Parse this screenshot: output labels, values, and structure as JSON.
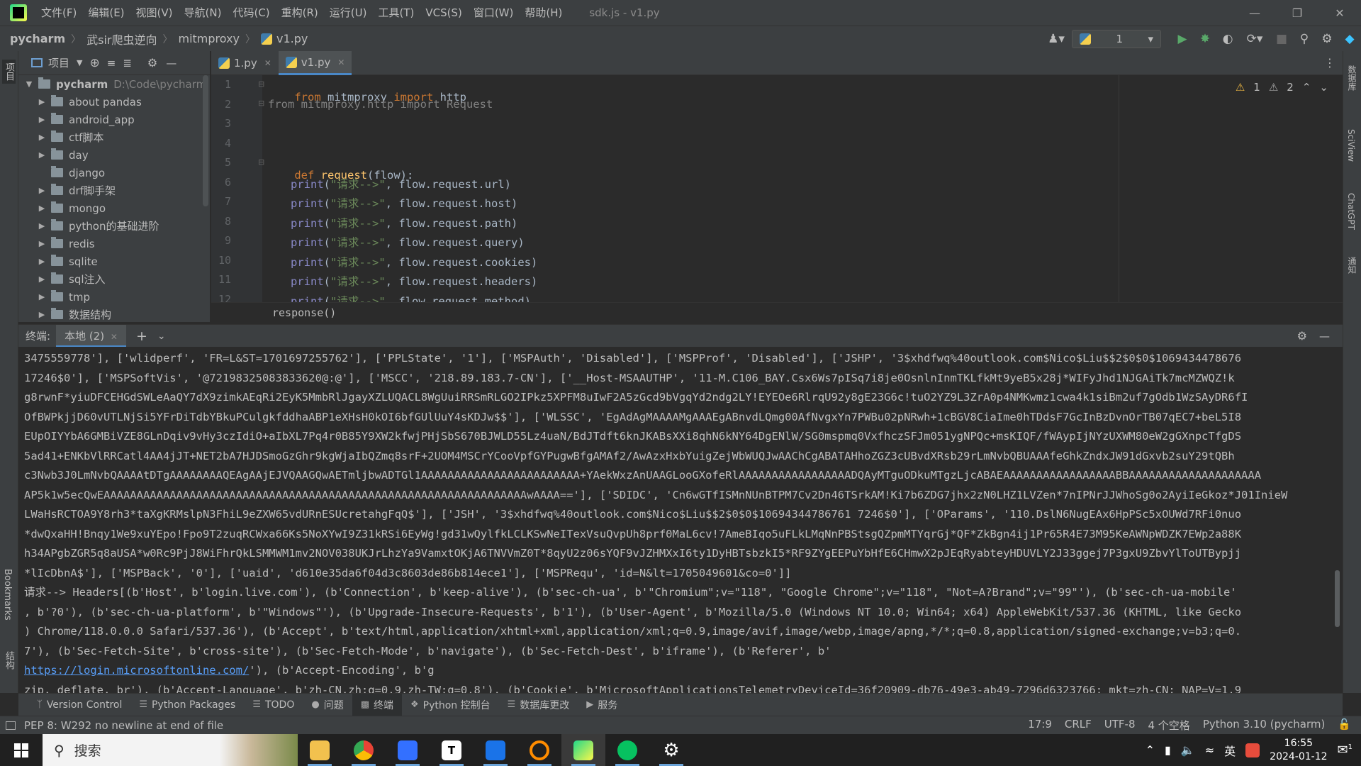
{
  "menubar": {
    "items": [
      "文件(F)",
      "编辑(E)",
      "视图(V)",
      "导航(N)",
      "代码(C)",
      "重构(R)",
      "运行(U)",
      "工具(T)",
      "VCS(S)",
      "窗口(W)",
      "帮助(H)"
    ],
    "title": "sdk.js - v1.py"
  },
  "navbar": {
    "crumbs": [
      "pycharm",
      "武sir爬虫逆向",
      "mitmproxy",
      "v1.py"
    ],
    "run_config": "1"
  },
  "left_strip": {
    "project": "项目",
    "bookmarks": "Bookmarks",
    "structure": "结构"
  },
  "right_strip": {
    "database": "数据库",
    "sciview": "SciView",
    "chatgpt": "ChatGPT",
    "notifications": "通知"
  },
  "project_panel": {
    "title": "项目",
    "root_name": "pycharm",
    "root_path": "D:\\Code\\pycharm",
    "folders": [
      {
        "name": "about pandas",
        "expandable": true
      },
      {
        "name": "android_app",
        "expandable": true
      },
      {
        "name": "ctf脚本",
        "expandable": true
      },
      {
        "name": "day",
        "expandable": true
      },
      {
        "name": "django",
        "expandable": false
      },
      {
        "name": "drf脚手架",
        "expandable": true
      },
      {
        "name": "mongo",
        "expandable": true
      },
      {
        "name": "python的基础进阶",
        "expandable": true
      },
      {
        "name": "redis",
        "expandable": true
      },
      {
        "name": "sqlite",
        "expandable": true
      },
      {
        "name": "sql注入",
        "expandable": true
      },
      {
        "name": "tmp",
        "expandable": true
      },
      {
        "name": "数据结构",
        "expandable": true
      }
    ]
  },
  "editor": {
    "tabs": [
      {
        "label": "1.py",
        "active": false
      },
      {
        "label": "v1.py",
        "active": true
      }
    ],
    "warnings": "1",
    "weak_warnings": "2",
    "line_numbers": [
      "1",
      "2",
      "3",
      "4",
      "5",
      "6",
      "7",
      "8",
      "9",
      "10",
      "11",
      "12"
    ],
    "lines": {
      "l1": {
        "kw1": "from",
        "mod": " mitmproxy ",
        "kw2": "import",
        "rest": " http"
      },
      "l2": "from mitmproxy.http import Request",
      "l5": {
        "kw": "def",
        "fn": "request",
        "rest": "(flow):"
      },
      "prints": [
        {
          "fn": "print",
          "str": "\"请求-->\"",
          "arg": "flow.request.url"
        },
        {
          "fn": "print",
          "str": "\"请求-->\"",
          "arg": "flow.request.host"
        },
        {
          "fn": "print",
          "str": "\"请求-->\"",
          "arg": "flow.request.path"
        },
        {
          "fn": "print",
          "str": "\"请求-->\"",
          "arg": "flow.request.query"
        },
        {
          "fn": "print",
          "str": "\"请求-->\"",
          "arg": "flow.request.cookies"
        },
        {
          "fn": "print",
          "str": "\"请求-->\"",
          "arg": "flow.request.headers"
        },
        {
          "fn": "print",
          "str": "\"请求-->\"",
          "arg": "flow.request.method"
        }
      ],
      "punct": {
        "open": "(",
        "comma": ", ",
        "close": ")"
      }
    },
    "breadcrumb": "response()"
  },
  "terminal": {
    "label": "终端:",
    "tab": "本地 (2)",
    "lines": [
      "3475559778'], ['wlidperf', 'FR=L&ST=1701697255762'], ['PPLState', '1'], ['MSPAuth', 'Disabled'], ['MSPProf', 'Disabled'], ['JSHP', '3$xhdfwq%40outlook.com$Nico$Liu$$2$0$0$1069434478676",
      "17246$0'], ['MSPSoftVis', '@72198325083833620@:@'], ['MSCC', '218.89.183.7-CN'], ['__Host-MSAAUTHP', '11-M.C106_BAY.Csx6Ws7pISq7i8je0OsnlnInmTKLfkMt9yeB5x28j*WIFyJhd1NJGAiTk7mcMZWQZ!k",
      "g8rwnF*yiuDFCEHGdSWLeAaQY7dX9zimkAEqRi2EyK5MmbRlJgayXZLUQACL8WgUuiRRSmRLGO2IPkz5XPFM8uIwF2A5zGcd9bVgqYd2ndg2LY!EYEOe6RlrqU92y8gE23G6c!tuO2YZ9L3ZrA0p4NMKwmz1cwa4k1siBm2uf7gOdb1WzSAyDR6fI",
      "OfBWPkjjD60vUTLNjSi5YFrDiTdbYBkuPCulgkfddhaABP1eXHsH0kOI6bfGUlUuY4sKDJw$$'], ['WLSSC', 'EgAdAgMAAAAMgAAAEgABnvdLQmg00AfNvgxYn7PWBu02pNRwh+1cBGV8CiaIme0hTDdsF7GcInBzDvnOrTB07qEC7+beL5I8",
      "EUpOIYYbA6GMBiVZE8GLnDqiv9vHy3czIdiO+aIbXL7Pq4r0B85Y9XW2kfwjPHjSbS670BJWLD55Lz4uaN/BdJTdft6knJKABsXXi8qhN6kNY64DgENlW/SG0mspmq0VxfhczSFJm051ygNPQc+msKIQF/fWAypIjNYzUXWM80eW2gGXnpcTfgDS",
      "5ad41+ENKbVlRRCatl4AA4jJT+NET2bA7HJDSmoGzGhr9kgWjaIbQZmq8srF+2UOM4MSCrYCooVpfGYPugwBfgAMAf2/AwAzxHxbYuigZejWbWUQJwAAChCgABATAHhoZGZ3cUBvdXRsb29rLmNvbQBUAAAfeGhkZndxJW91dGxvb2suY29tQBh",
      "c3Nwb3J0LmNvbQAAAAtDTgAAAAAAAAQEAgAAjEJVQAAGQwAETmljbwADTGl1AAAAAAAAAAAAAAAAAAAAAAAA+YAekWxzAnUAAGLooGXofeRlAAAAAAAAAAAAAAAAADQAyMTguODkuMTgzLjcABAEAAAAAAAAAAAAAAAAABBAAAAAAAAAAAAAAAAAAAA",
      "AP5k1w5ecQwEAAAAAAAAAAAAAAAAAAAAAAAAAAAAAAAAAAAAAAAAAAAAAAAAAAAAAAAAAAAAAAAAwAAAA=='], ['SDIDC', 'Cn6wGTfISMnNUnBTPM7Cv2Dn46TSrkAM!Ki7b6ZDG7jhx2zN0LHZ1LVZen*7nIPNrJJWhoSg0o2AyiIeGkoz*J01InieW",
      "LWaHsRCTOA9Y8rh3*taXgKRMslpN3FhiL9eZXW65vdURnESUcretahgFqQ$'], ['JSH', '3$xhdfwq%40outlook.com$Nico$Liu$$2$0$0$10694344786761 7246$0'], ['OParams', '110.DslN6NugEAx6HpPSc5xOUWd7RFi0nuo",
      "*dwQxaHH!Bnqy1We9xuYEpo!Fpo9T2zuqRCWxa66Ks5NoXYwI9Z31kRSi6EyWg!gd31wQylfkLCLKSwNeITexVsuQvpUh8prf0MaL6cv!7AmeBIqo5uFLkLMqNnPBStsgQZpmMTYqrGj*QF*ZkBgn4ij1Pr65R4E73M95KeAWNpWDZK7EWp2a88K",
      "h34APgbZGR5q8aUSA*w0Rc9PjJ8WiFhrQkLSMMWM1mv2NOV038UKJrLhzYa9VamxtOKjA6TNVVmZ0T*8qyU2z06sYQF9vJZHMXxI6ty1DyHBTsbzkI5*RF9ZYgEEPuYbHfE6CHmwX2pJEqRyabteyHDUVLY2J33ggej7P3gxU9ZbvYlToUTBypjj",
      "*lIcDbnA$'], ['MSPBack', '0'], ['uaid', 'd610e35da6f04d3c8603de86b814ece1'], ['MSPRequ', 'id=N&lt=1705049601&co=0']]",
      "请求--> Headers[(b'Host', b'login.live.com'), (b'Connection', b'keep-alive'), (b'sec-ch-ua', b'\"Chromium\";v=\"118\", \"Google Chrome\";v=\"118\", \"Not=A?Brand\";v=\"99\"'), (b'sec-ch-ua-mobile'",
      ", b'?0'), (b'sec-ch-ua-platform', b'\"Windows\"'), (b'Upgrade-Insecure-Requests', b'1'), (b'User-Agent', b'Mozilla/5.0 (Windows NT 10.0; Win64; x64) AppleWebKit/537.36 (KHTML, like Gecko",
      ") Chrome/118.0.0.0 Safari/537.36'), (b'Accept', b'text/html,application/xhtml+xml,application/xml;q=0.9,image/avif,image/webp,image/apng,*/*;q=0.8,application/signed-exchange;v=b3;q=0.",
      "7'), (b'Sec-Fetch-Site', b'cross-site'), (b'Sec-Fetch-Mode', b'navigate'), (b'Sec-Fetch-Dest', b'iframe'), (b'Referer', b'"
    ],
    "referer_link": "https://login.microsoftonline.com/",
    "referer_tail": "'), (b'Accept-Encoding', b'g",
    "last_line": "zip, deflate, br'), (b'Accept-Language', b'zh-CN,zh;q=0.9,zh-TW;q=0.8'), (b'Cookie', b'MicrosoftApplicationsTelemetryDeviceId=36f20909-db76-49e3-ab49-7296d6323766; mkt=zh-CN; NAP=V=1.9"
  },
  "tool_strip": {
    "items": [
      "Version Control",
      "Python Packages",
      "TODO",
      "问题",
      "终端",
      "Python 控制台",
      "数据库更改",
      "服务"
    ],
    "active": "终端"
  },
  "status": {
    "message": "PEP 8: W292 no newline at end of file",
    "position": "17:9",
    "line_sep": "CRLF",
    "encoding": "UTF-8",
    "indent": "4 个空格",
    "interpreter": "Python 3.10 (pycharm)"
  },
  "taskbar": {
    "search_placeholder": "搜索",
    "apps": [
      {
        "name": "file-explorer",
        "color": "#f2c14e"
      },
      {
        "name": "chrome",
        "color": "#e84335"
      },
      {
        "name": "feishu",
        "color": "#3370ff"
      },
      {
        "name": "typora",
        "color": "#ffffff"
      },
      {
        "name": "mail",
        "color": "#1a73e8"
      },
      {
        "name": "search-tool",
        "color": "#ff8c00"
      },
      {
        "name": "pycharm",
        "color": "#21d789"
      },
      {
        "name": "wechat",
        "color": "#07c160"
      },
      {
        "name": "settings",
        "color": "#ffffff"
      }
    ],
    "ime": "英",
    "time": "16:55",
    "date": "2024-01-12",
    "notifications": "1"
  }
}
